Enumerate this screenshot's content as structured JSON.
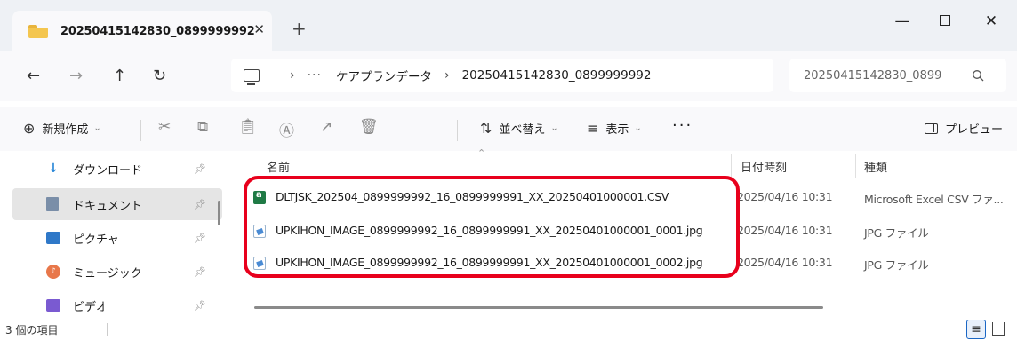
{
  "tab": {
    "title": "20250415142830_0899999992",
    "close": "✕",
    "new_tab": "+"
  },
  "window": {
    "minimize": "—",
    "close": "✕"
  },
  "nav": {
    "back": "←",
    "forward": "→",
    "up": "↑",
    "refresh": "↻"
  },
  "address": {
    "sep": "›",
    "more": "···",
    "segments": [
      "ケアプランデータ",
      "20250415142830_0899999992"
    ]
  },
  "search": {
    "placeholder": "20250415142830_0899",
    "icon": "search-icon"
  },
  "command_bar": {
    "new_label": "新規作成",
    "sort_label": "並べ替え",
    "view_label": "表示",
    "more": "···",
    "preview_label": "プレビュー"
  },
  "nav_pane": {
    "items": [
      {
        "label": "ダウンロード",
        "icon": "download-icon"
      },
      {
        "label": "ドキュメント",
        "icon": "documents-icon"
      },
      {
        "label": "ピクチャ",
        "icon": "pictures-icon"
      },
      {
        "label": "ミュージック",
        "icon": "music-icon"
      },
      {
        "label": "ビデオ",
        "icon": "videos-icon"
      }
    ]
  },
  "columns": {
    "name": "名前",
    "date": "日付時刻",
    "type": "種類"
  },
  "files": [
    {
      "name": "DLTJSK_202504_0899999992_16_0899999991_XX_20250401000001.CSV",
      "date": "2025/04/16 10:31",
      "type": "Microsoft Excel CSV ファ...",
      "icon": "excel-csv-icon"
    },
    {
      "name": "UPKIHON_IMAGE_0899999992_16_0899999991_XX_20250401000001_0001.jpg",
      "date": "2025/04/16 10:31",
      "type": "JPG ファイル",
      "icon": "jpg-file-icon"
    },
    {
      "name": "UPKIHON_IMAGE_0899999992_16_0899999991_XX_20250401000001_0002.jpg",
      "date": "2025/04/16 10:31",
      "type": "JPG ファイル",
      "icon": "jpg-file-icon"
    }
  ],
  "status": {
    "item_count": "3 個の項目"
  },
  "colors": {
    "highlight": "#e8001c",
    "accent": "#1a66c4",
    "selected": "#e5e5e5"
  }
}
